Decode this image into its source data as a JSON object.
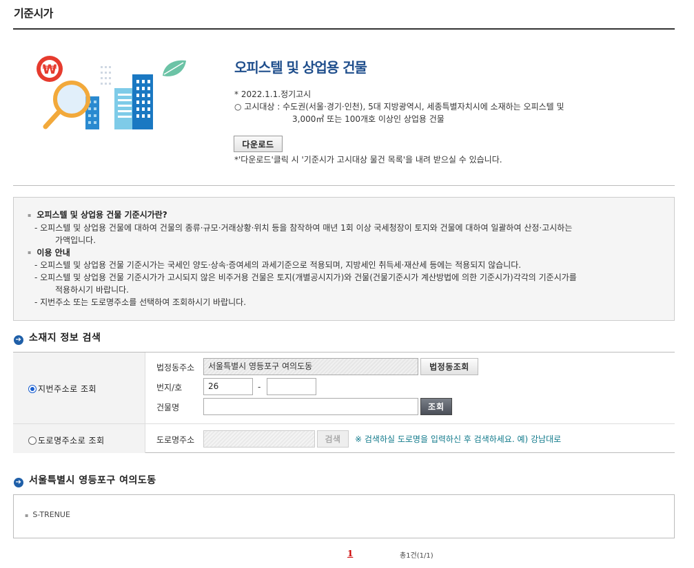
{
  "page": {
    "title": "기준시가"
  },
  "hero": {
    "heading": "오피스텔 및 상업용 건물",
    "date": "* 2022.1.1.정기고시",
    "target_line1": "○ 고시대상 : 수도권(서울·경기·인천), 5대 지방광역시, 세종특별자치시에 소재하는 오피스텔 및",
    "target_line2": "3,000㎡ 또는 100개호 이상인 상업용 건물",
    "download_label": "다운로드",
    "download_note": "*'다운로드'클릭 시 '기준시가 고시대상 물건 목록'을 내려 받으실 수 있습니다."
  },
  "info": {
    "heading1": "오피스텔 및 상업용 건물 기준시가란?",
    "line1a": "- 오피스텔 및 상업용 건물에 대하여 건물의 종류·규모·거래상황·위치 등을 참작하여 매년 1회 이상 국세청장이 토지와 건물에 대하여 일괄하여 산정·고시하는",
    "line1b": "가액입니다.",
    "heading2": "이용 안내",
    "line2": "- 오피스텔 및 상업용 건물 기준시가는 국세인 양도·상속·증여세의 과세기준으로 적용되며, 지방세인 취득세·재산세 등에는 적용되지 않습니다.",
    "line3a": "- 오피스텔 및 상업용 건물 기준시가가 고시되지 않은 비주거용 건물은 토지(개별공시지가)와 건물(건물기준시가 계산방법에 의한 기준시가)각각의 기준시가를",
    "line3b": "적용하시기 바랍니다.",
    "line4": "- 지번주소 또는 도로명주소를 선택하여 조회하시기 바랍니다."
  },
  "search": {
    "section_title": "소재지 정보 검색",
    "jibeon_radio_label": "지번주소로 조회",
    "road_radio_label": "도로명주소로 조회",
    "legal_dong_label": "법정동주소",
    "legal_dong_value": "서울특별시 영등포구 여의도동",
    "legal_dong_button": "법정동조회",
    "bunji_label": "번지/호",
    "bunji_value": "26",
    "bunji_dash": "-",
    "ho_value": "",
    "building_label": "건물명",
    "building_value": "",
    "search_button": "조회",
    "road_label": "도로명주소",
    "road_value": "",
    "road_search_button": "검색",
    "road_hint": "※ 검색하실 도로명을 입력하신 후 검색하세요. 예) 강남대로"
  },
  "results": {
    "section_title": "서울특별시 영등포구 여의도동",
    "items": [
      "S-TRENUE"
    ]
  },
  "pager": {
    "current": "1",
    "total": "총1건(1/1)"
  },
  "colors": {
    "accent": "#1f4e8c",
    "bullet": "#1f5fa8",
    "hint": "#117a8b",
    "pager": "#cc0000"
  }
}
